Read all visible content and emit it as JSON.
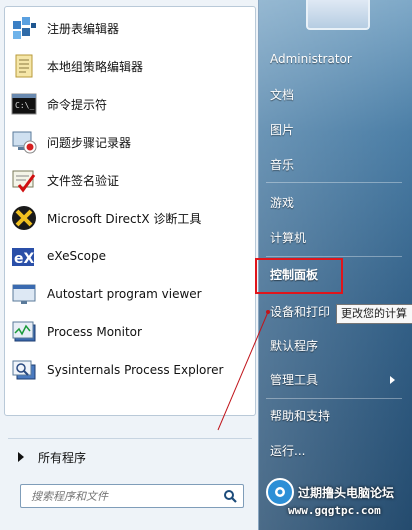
{
  "programs": [
    {
      "label": "注册表编辑器",
      "icon": "registry-editor-icon"
    },
    {
      "label": "本地组策略编辑器",
      "icon": "group-policy-icon"
    },
    {
      "label": "命令提示符",
      "icon": "command-prompt-icon"
    },
    {
      "label": "问题步骤记录器",
      "icon": "steps-recorder-icon"
    },
    {
      "label": "文件签名验证",
      "icon": "file-signature-icon"
    },
    {
      "label": "Microsoft DirectX 诊断工具",
      "icon": "directx-icon"
    },
    {
      "label": "eXeScope",
      "icon": "exescope-icon"
    },
    {
      "label": "Autostart program viewer",
      "icon": "autostart-icon"
    },
    {
      "label": "Process Monitor",
      "icon": "process-monitor-icon"
    },
    {
      "label": "Sysinternals Process Explorer",
      "icon": "process-explorer-icon"
    }
  ],
  "all_programs_label": "所有程序",
  "search": {
    "placeholder": "搜索程序和文件"
  },
  "right_menu": {
    "user": "Administrator",
    "documents": "文档",
    "pictures": "图片",
    "music": "音乐",
    "games": "游戏",
    "computer": "计算机",
    "control_panel": "控制面板",
    "devices_printers": "设备和打印",
    "default_programs": "默认程序",
    "admin_tools": "管理工具",
    "help_support": "帮助和支持",
    "run": "运行..."
  },
  "tooltip": "更改您的计算",
  "watermark": {
    "title": "过期撸头电脑论坛",
    "url": "www.gqgtpc.com"
  },
  "colors": {
    "highlight": "#e0151b",
    "annotation_line": "#c0151b"
  }
}
